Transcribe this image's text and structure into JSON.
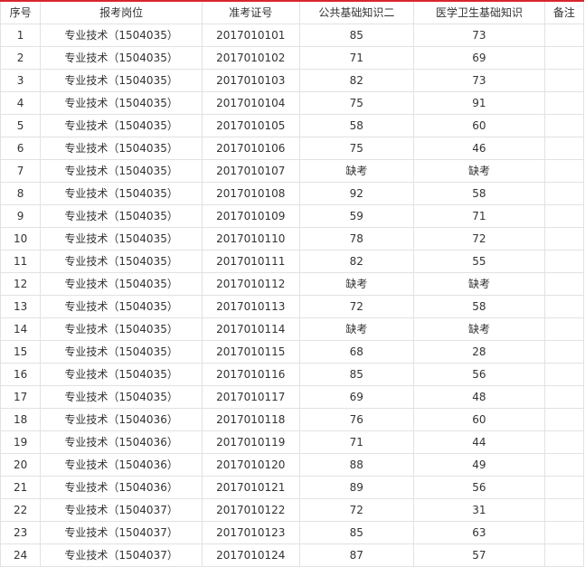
{
  "table": {
    "headers": {
      "seq": "序号",
      "post": "报考岗位",
      "ticket": "准考证号",
      "public": "公共基础知识二",
      "medical": "医学卫生基础知识",
      "note": "备注"
    },
    "rows": [
      {
        "seq": "1",
        "post": "专业技术（1504035）",
        "ticket": "2017010101",
        "public": "85",
        "medical": "73",
        "note": ""
      },
      {
        "seq": "2",
        "post": "专业技术（1504035）",
        "ticket": "2017010102",
        "public": "71",
        "medical": "69",
        "note": ""
      },
      {
        "seq": "3",
        "post": "专业技术（1504035）",
        "ticket": "2017010103",
        "public": "82",
        "medical": "73",
        "note": ""
      },
      {
        "seq": "4",
        "post": "专业技术（1504035）",
        "ticket": "2017010104",
        "public": "75",
        "medical": "91",
        "note": ""
      },
      {
        "seq": "5",
        "post": "专业技术（1504035）",
        "ticket": "2017010105",
        "public": "58",
        "medical": "60",
        "note": ""
      },
      {
        "seq": "6",
        "post": "专业技术（1504035）",
        "ticket": "2017010106",
        "public": "75",
        "medical": "46",
        "note": ""
      },
      {
        "seq": "7",
        "post": "专业技术（1504035）",
        "ticket": "2017010107",
        "public": "缺考",
        "medical": "缺考",
        "note": ""
      },
      {
        "seq": "8",
        "post": "专业技术（1504035）",
        "ticket": "2017010108",
        "public": "92",
        "medical": "58",
        "note": ""
      },
      {
        "seq": "9",
        "post": "专业技术（1504035）",
        "ticket": "2017010109",
        "public": "59",
        "medical": "71",
        "note": ""
      },
      {
        "seq": "10",
        "post": "专业技术（1504035）",
        "ticket": "2017010110",
        "public": "78",
        "medical": "72",
        "note": ""
      },
      {
        "seq": "11",
        "post": "专业技术（1504035）",
        "ticket": "2017010111",
        "public": "82",
        "medical": "55",
        "note": ""
      },
      {
        "seq": "12",
        "post": "专业技术（1504035）",
        "ticket": "2017010112",
        "public": "缺考",
        "medical": "缺考",
        "note": ""
      },
      {
        "seq": "13",
        "post": "专业技术（1504035）",
        "ticket": "2017010113",
        "public": "72",
        "medical": "58",
        "note": ""
      },
      {
        "seq": "14",
        "post": "专业技术（1504035）",
        "ticket": "2017010114",
        "public": "缺考",
        "medical": "缺考",
        "note": ""
      },
      {
        "seq": "15",
        "post": "专业技术（1504035）",
        "ticket": "2017010115",
        "public": "68",
        "medical": "28",
        "note": ""
      },
      {
        "seq": "16",
        "post": "专业技术（1504035）",
        "ticket": "2017010116",
        "public": "85",
        "medical": "56",
        "note": ""
      },
      {
        "seq": "17",
        "post": "专业技术（1504035）",
        "ticket": "2017010117",
        "public": "69",
        "medical": "48",
        "note": ""
      },
      {
        "seq": "18",
        "post": "专业技术（1504036）",
        "ticket": "2017010118",
        "public": "76",
        "medical": "60",
        "note": ""
      },
      {
        "seq": "19",
        "post": "专业技术（1504036）",
        "ticket": "2017010119",
        "public": "71",
        "medical": "44",
        "note": ""
      },
      {
        "seq": "20",
        "post": "专业技术（1504036）",
        "ticket": "2017010120",
        "public": "88",
        "medical": "49",
        "note": ""
      },
      {
        "seq": "21",
        "post": "专业技术（1504036）",
        "ticket": "2017010121",
        "public": "89",
        "medical": "56",
        "note": ""
      },
      {
        "seq": "22",
        "post": "专业技术（1504037）",
        "ticket": "2017010122",
        "public": "72",
        "medical": "31",
        "note": ""
      },
      {
        "seq": "23",
        "post": "专业技术（1504037）",
        "ticket": "2017010123",
        "public": "85",
        "medical": "63",
        "note": ""
      },
      {
        "seq": "24",
        "post": "专业技术（1504037）",
        "ticket": "2017010124",
        "public": "87",
        "medical": "57",
        "note": ""
      }
    ]
  },
  "colors": {
    "header_accent": "#d9262e",
    "border": "#e2e2e2",
    "text": "#333333"
  }
}
